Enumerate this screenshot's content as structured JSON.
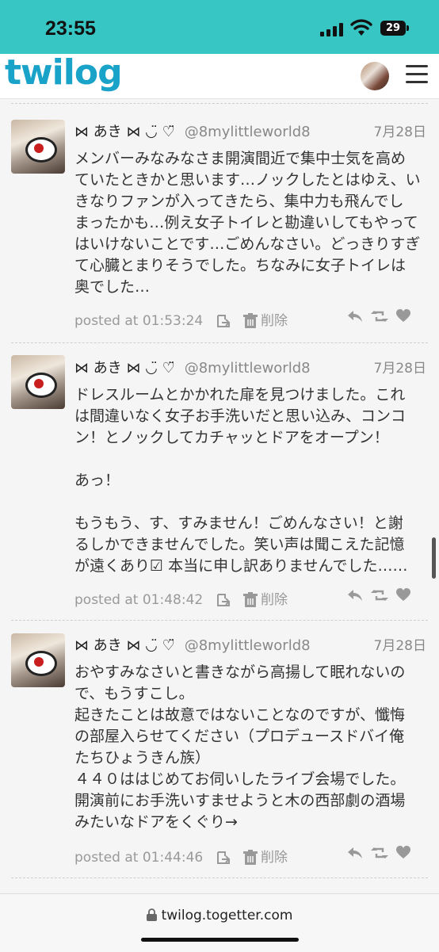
{
  "status": {
    "time": "23:55",
    "battery": "29"
  },
  "header": {
    "logo": "twilog"
  },
  "tweets": [
    {
      "name": "⋈ あき ⋈ ◡̈ ♡̈",
      "handle": "@8mylittleworld8",
      "date": "7月28日",
      "body": "メンバーみなみなさま開演間近で集中士気を高め\nていたときかと思います…ノックしたとはゆえ、い\nきなりファンが入ってきたら、集中力も飛んでし\nまったかも…例え女子トイレと勘違いしてもやって\nはいけないことです…ごめんなさい。どっきりすぎ\nて心臓とまりそうでした。ちなみに女子トイレは\n奥でした…",
      "posted": "posted at 01:53:24",
      "delete_label": "削除"
    },
    {
      "name": "⋈ あき ⋈ ◡̈ ♡̈",
      "handle": "@8mylittleworld8",
      "date": "7月28日",
      "body": "ドレスルームとかかれた扉を見つけました。これ\nは間違いなく女子お手洗いだと思い込み、コンコ\nン！とノックしてカチャッとドアをオープン！\n\nあっ！\n\nもうもう、す、すみません！ごめんなさい！と謝\nるしかできませんでした。笑い声は聞こえた記憶\nが遠くあり☑ 本当に申し訳ありませんでした……",
      "posted": "posted at 01:48:42",
      "delete_label": "削除"
    },
    {
      "name": "⋈ あき ⋈ ◡̈ ♡̈",
      "handle": "@8mylittleworld8",
      "date": "7月28日",
      "body": "おやすみなさいと書きながら高揚して眠れないの\nで、もうすこし。\n起きたことは故意ではないことなのですが、懺悔\nの部屋入らせてください（プロデュースドバイ俺\nたちひょうきん族）\n４４０ははじめてお伺いしたライブ会場でした。\n開演前にお手洗いすませようと木の西部劇の酒場\nみたいなドアをくぐり→",
      "posted": "posted at 01:44:46",
      "delete_label": "削除"
    }
  ],
  "browser": {
    "url": "twilog.togetter.com"
  }
}
